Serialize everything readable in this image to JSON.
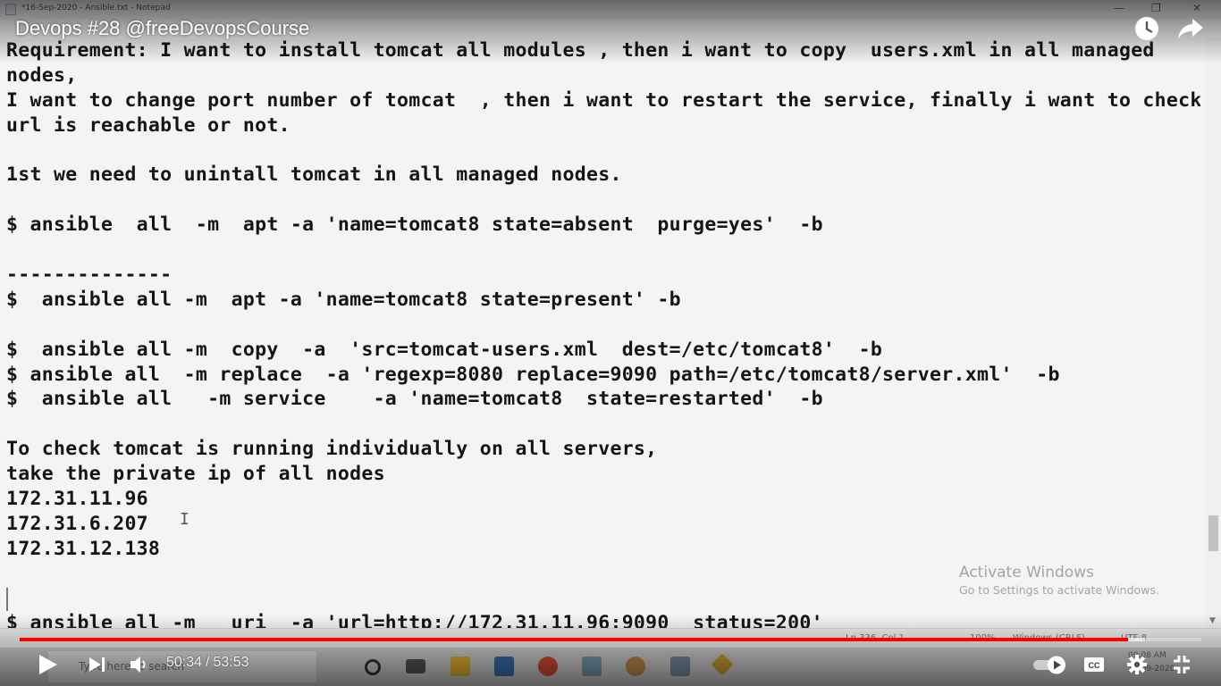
{
  "player": {
    "video_title": "Devops #28 @freeDevopsCourse",
    "current_time": "50:34",
    "duration": "53:53",
    "time_separator": "/",
    "progress_fraction": 0.938,
    "buffered_fraction": 0.952,
    "progress_color": "#ff0000",
    "icons": [
      "watch-later-icon",
      "share-icon",
      "play-icon",
      "next-icon",
      "volume-icon",
      "autoplay-toggle-icon",
      "subtitles-icon",
      "settings-icon",
      "exit-fullscreen-icon"
    ]
  },
  "notepad": {
    "window_title": "*16-Sep-2020 - Ansible.txt - Notepad",
    "lines": [
      "Requirement: I want to install tomcat all modules , then i want to copy  users.xml in all managed",
      "nodes,",
      "I want to change port number of tomcat  , then i want to restart the service, finally i want to check",
      "url is reachable or not.",
      "",
      "1st we need to unintall tomcat in all managed nodes.",
      "",
      "$ ansible  all  -m  apt -a 'name=tomcat8 state=absent  purge=yes'  -b",
      "",
      "--------------",
      "$  ansible all -m  apt -a 'name=tomcat8 state=present' -b",
      "",
      "$  ansible all -m  copy  -a  'src=tomcat-users.xml  dest=/etc/tomcat8'  -b",
      "$ ansible all  -m replace  -a 'regexp=8080 replace=9090 path=/etc/tomcat8/server.xml'  -b",
      "$  ansible all   -m service    -a 'name=tomcat8  state=restarted'  -b",
      "",
      "To check tomcat is running individually on all servers,",
      "take the private ip of all nodes",
      "172.31.11.96",
      "172.31.6.207",
      "172.31.12.138",
      "",
      "",
      "$ ansible all -m   uri  -a 'url=http://172.31.11.96:9090  status=200'"
    ],
    "status": {
      "position": "Ln 336, Col 1",
      "zoom": "100%",
      "line_endings": "Windows (CRLF)",
      "encoding": "UTF-8"
    }
  },
  "watermark": {
    "title": "Activate Windows",
    "subtitle": "Go to Settings to activate Windows."
  },
  "taskbar": {
    "search_placeholder": "Type here to search",
    "clock_time": "09:08 AM",
    "clock_date": "16-09-2020"
  }
}
